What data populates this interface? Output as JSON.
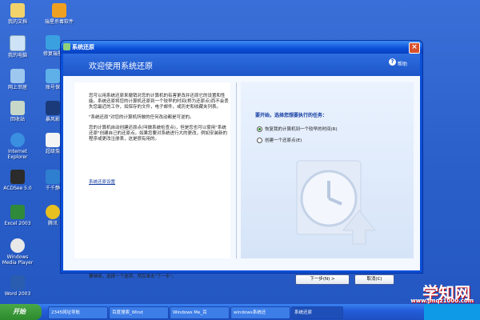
{
  "desktop": {
    "icons": [
      {
        "label": "我的文档"
      },
      {
        "label": "瑞星杀毒软件"
      },
      {
        "label": "我的电脑"
      },
      {
        "label": "修复瑞星"
      },
      {
        "label": "网上邻居"
      },
      {
        "label": "账号保"
      },
      {
        "label": "回收站"
      },
      {
        "label": "暴风影"
      },
      {
        "label": "Internet Explorer"
      },
      {
        "label": "超级兔"
      },
      {
        "label": "ACDSee 5.0"
      },
      {
        "label": "千千静"
      },
      {
        "label": "Excel 2003"
      },
      {
        "label": "腾讯"
      },
      {
        "label": "Windows Media Player"
      },
      {
        "label": "Word 2003"
      }
    ]
  },
  "window": {
    "title": "系统还原",
    "banner_title": "欢迎使用系统还原",
    "help_label": "帮助",
    "intro_paragraphs": [
      "您可以用系统还原来撤销对您的计算机的有害更改并还原它的设置和性能。系统还原将您的计算机还原到一个较早的时间(称为还原点)而不会丢失您最近的工作，如保存的文件，电子邮件，或历史和收藏夹列表。",
      "\"系统还原\"对您的计算机所做的任何改动都是可逆的。",
      "您的计算机自动创建还原点(叫做系统检查点)，但是您也可以使用\"系统还原\"创建自己的还原点。如果您要对系统进行大的更改，例如安装新的程序或更改注册表，这是很有用的。"
    ],
    "settings_link": "系统还原设置",
    "footer_text": "要继续，选择一个选项，然后单击\"下一步\"。",
    "prompt": "要开始，选择您想要执行的任务：",
    "options": [
      {
        "label": "恢复我的计算机到一个较早的时间(R)",
        "selected": true
      },
      {
        "label": "创建一个还原点(E)",
        "selected": false
      }
    ],
    "next_button": "下一步(N) >",
    "cancel_button": "取消(C)"
  },
  "taskbar": {
    "start_label": "开始",
    "tasks": [
      {
        "label": "2345网址导航"
      },
      {
        "label": "百度搜索_Wind"
      },
      {
        "label": "Windows Me_百"
      },
      {
        "label": "windows系统还"
      },
      {
        "label": "系统还原"
      }
    ]
  },
  "watermark": {
    "brand": "学知网",
    "url": "www.jmqz1000.com"
  },
  "colors": {
    "desktop_blue": "#2a5fc9",
    "title_blue": "#0a4fd8",
    "link_blue": "#103aa0",
    "start_green": "#2d8a2d"
  }
}
